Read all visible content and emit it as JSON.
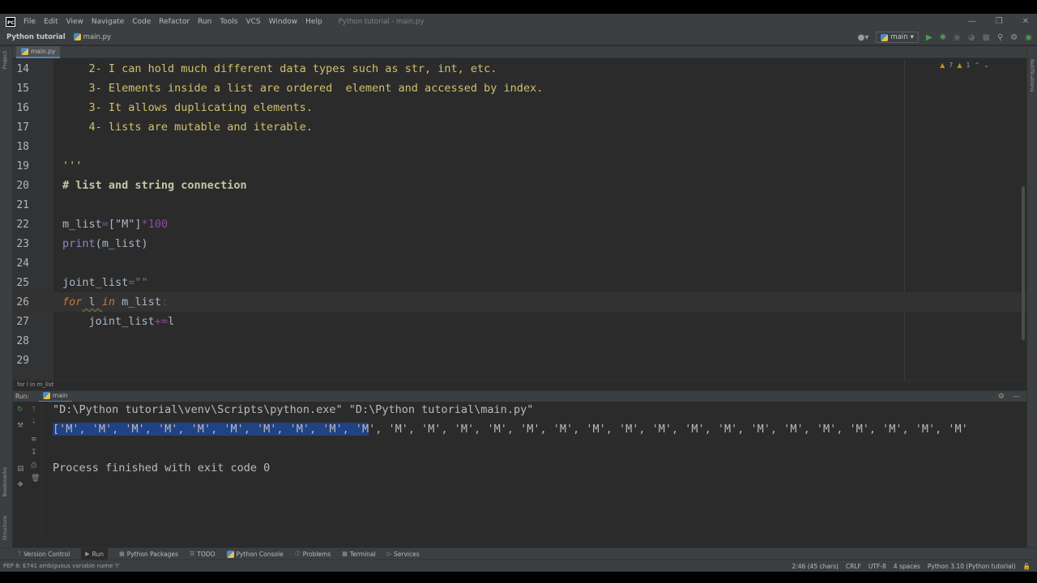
{
  "menubar": {
    "items": [
      "File",
      "Edit",
      "View",
      "Navigate",
      "Code",
      "Refactor",
      "Run",
      "Tools",
      "VCS",
      "Window",
      "Help"
    ],
    "window_title": "Python tutorial - main.py"
  },
  "navbar": {
    "project": "Python tutorial",
    "file": "main.py",
    "run_config": "main"
  },
  "left_strip": {
    "project": "Project",
    "bookmarks": "Bookmarks",
    "structure": "Structure"
  },
  "right_strip": {
    "notifications": "Notifications"
  },
  "editor": {
    "tab": "main.py",
    "inspection": {
      "warnings": "7",
      "weak": "1"
    },
    "line_numbers": [
      "14",
      "15",
      "16",
      "17",
      "18",
      "19",
      "20",
      "21",
      "22",
      "23",
      "24",
      "25",
      "26",
      "27",
      "28",
      "29"
    ],
    "lines": {
      "l14": "    2- I can hold much different data types such as str, int, etc.",
      "l15": "    3- Elements inside a list are ordered  element and accessed by index.",
      "l16": "    3- It allows duplicating elements.",
      "l17": "    4- lists are mutable and iterable.",
      "l19": "'''",
      "l20": "# list and string connection",
      "l22_var": "m_list",
      "l22_eq": "=",
      "l22_list": "[\"M\"]",
      "l22_op": "*",
      "l22_num": "100",
      "l23_fn": "print",
      "l23_rest": "(m_list)",
      "l25_var": "joint_list",
      "l25_eq": "=",
      "l25_str": "\"\"",
      "l26_for": "for",
      "l26_var": " l ",
      "l26_in": "in",
      "l26_rest": " m_list",
      "l26_colon": ":",
      "l27_var": "    joint_list",
      "l27_op": "+=",
      "l27_l": "l"
    },
    "breadcrumb": "for l in m_list"
  },
  "run": {
    "label": "Run:",
    "tab": "main",
    "command": "\"D:\\Python tutorial\\venv\\Scripts\\python.exe\" \"D:\\Python tutorial\\main.py\"",
    "output_selected": "['M', 'M', 'M', 'M', 'M', 'M', 'M', 'M', 'M', 'M",
    "output_rest": "', 'M', 'M', 'M', 'M', 'M', 'M', 'M', 'M', 'M', 'M', 'M', 'M', 'M', 'M', 'M', 'M', 'M', 'M'",
    "exit_message": "Process finished with exit code 0"
  },
  "tool_windows": [
    "Version Control",
    "Run",
    "Python Packages",
    "TODO",
    "Python Console",
    "Problems",
    "Terminal",
    "Services"
  ],
  "status": {
    "message": "PEP 8: E741 ambiguous variable name 'l'",
    "position": "2:46 (45 chars)",
    "line_sep": "CRLF",
    "encoding": "UTF-8",
    "indent": "4 spaces",
    "interpreter": "Python 3.10 (Python tutorial)"
  }
}
